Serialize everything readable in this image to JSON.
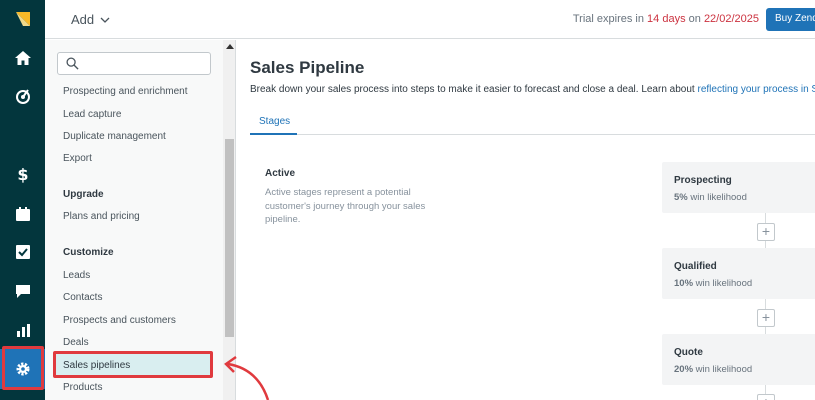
{
  "topbar": {
    "add_label": "Add",
    "trial_prefix": "Trial expires in ",
    "trial_days": "14 days",
    "trial_middle": " on ",
    "trial_date": "22/02/2025",
    "buy_label": "Buy Zendesk"
  },
  "rail": {
    "icons": [
      "logo-icon",
      "home-icon",
      "leads-icon",
      "dollar-icon",
      "calendar-icon",
      "tasks-icon",
      "chat-icon",
      "reports-icon",
      "gear-icon"
    ]
  },
  "sidebar": {
    "search_placeholder": "",
    "items_top": [
      "Prospecting and enrichment",
      "Lead capture",
      "Duplicate management",
      "Export"
    ],
    "upgrade_header": "Upgrade",
    "upgrade_items": [
      "Plans and pricing"
    ],
    "customize_header": "Customize",
    "customize_items": [
      "Leads",
      "Contacts",
      "Prospects and customers",
      "Deals"
    ],
    "active_item": "Sales pipelines",
    "after_items": [
      "Products"
    ]
  },
  "main": {
    "title": "Sales Pipeline",
    "description": "Break down your sales process into steps to make it easier to forecast and close a deal. Learn about ",
    "description_link": "reflecting your process in Sell",
    "tabs": [
      {
        "label": "Stages"
      }
    ],
    "active_section": {
      "title": "Active",
      "description": "Active stages represent a potential customer's journey through your sales pipeline."
    },
    "stages": [
      {
        "name": "Prospecting",
        "percent": "5%",
        "suffix": " win likelihood"
      },
      {
        "name": "Qualified",
        "percent": "10%",
        "suffix": " win likelihood"
      },
      {
        "name": "Quote",
        "percent": "20%",
        "suffix": " win likelihood"
      }
    ],
    "add_stage_label": "+"
  },
  "colors": {
    "rail_bg": "#03363d",
    "accent": "#1f73b7",
    "highlight": "#e03a3e",
    "trial_red": "#cc3340"
  }
}
